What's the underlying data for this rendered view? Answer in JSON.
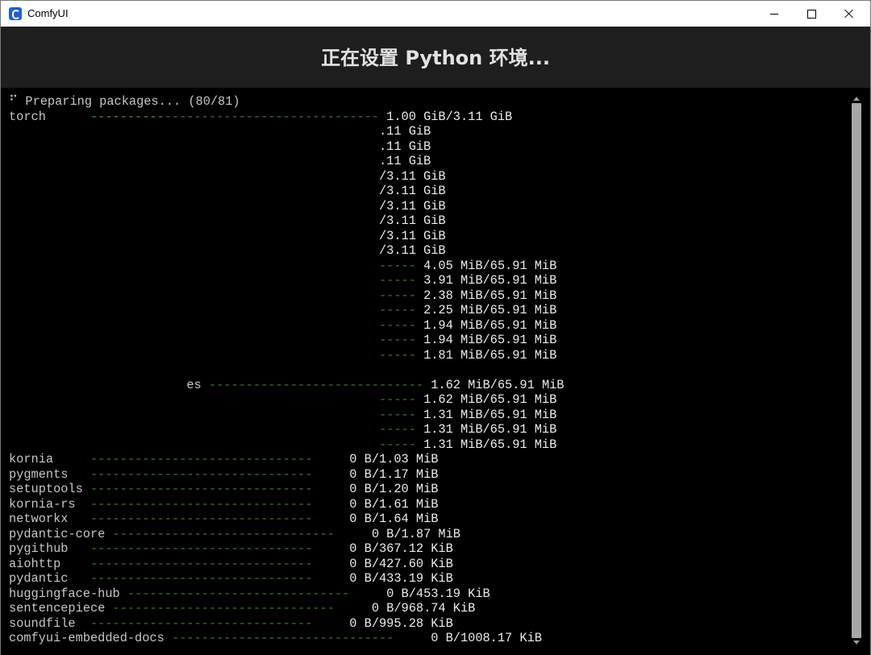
{
  "window": {
    "title": "ComfyUI",
    "icon": "comfyui-logo-icon",
    "controls": {
      "minimize": "minimize-icon",
      "maximize": "maximize-icon",
      "close": "close-icon"
    }
  },
  "header": {
    "title": "正在设置 Python 环境..."
  },
  "terminal": {
    "lines": [
      {
        "pre": "",
        "label": "⠋ Preparing packages... (80/81)",
        "dim": "",
        "bar": "",
        "value": ""
      },
      {
        "pre": "",
        "label": "torch      ",
        "dim": "",
        "bar": "----------------------------- ",
        "value": "1.00 GiB/3.11 GiB",
        "bright_dash": "----------"
      },
      {
        "pre": "                                                  ",
        "label": "",
        "dim": "",
        "bar": "",
        "value": ".11 GiB"
      },
      {
        "pre": "                                                  ",
        "label": "",
        "dim": "",
        "bar": "",
        "value": ".11 GiB"
      },
      {
        "pre": "                                                  ",
        "label": "",
        "dim": "",
        "bar": "",
        "value": ".11 GiB"
      },
      {
        "pre": "                                                  ",
        "label": "",
        "dim": "",
        "bar": "",
        "value": "/3.11 GiB"
      },
      {
        "pre": "                                                  ",
        "label": "",
        "dim": "",
        "bar": "",
        "value": "/3.11 GiB"
      },
      {
        "pre": "                                                  ",
        "label": "",
        "dim": "",
        "bar": "",
        "value": "/3.11 GiB"
      },
      {
        "pre": "                                                  ",
        "label": "",
        "dim": "",
        "bar": "",
        "value": "/3.11 GiB"
      },
      {
        "pre": "                                                  ",
        "label": "",
        "dim": "",
        "bar": "",
        "value": "/3.11 GiB"
      },
      {
        "pre": "                                                  ",
        "label": "",
        "dim": "",
        "bar": "",
        "value": "/3.11 GiB"
      },
      {
        "pre": "                                                  ",
        "label": "",
        "dim": "",
        "bar": "----- ",
        "value": "4.05 MiB/65.91 MiB"
      },
      {
        "pre": "                                                  ",
        "label": "",
        "dim": "",
        "bar": "----- ",
        "value": "3.91 MiB/65.91 MiB"
      },
      {
        "pre": "                                                  ",
        "label": "",
        "dim": "",
        "bar": "----- ",
        "value": "2.38 MiB/65.91 MiB"
      },
      {
        "pre": "                                                  ",
        "label": "",
        "dim": "",
        "bar": "----- ",
        "value": "2.25 MiB/65.91 MiB"
      },
      {
        "pre": "                                                  ",
        "label": "",
        "dim": "",
        "bar": "----- ",
        "value": "1.94 MiB/65.91 MiB"
      },
      {
        "pre": "                                                  ",
        "label": "",
        "dim": "",
        "bar": "----- ",
        "value": "1.94 MiB/65.91 MiB"
      },
      {
        "pre": "                                                  ",
        "label": "",
        "dim": "",
        "bar": "----- ",
        "value": "1.81 MiB/65.91 MiB"
      },
      {
        "pre": "",
        "label": "",
        "dim": "",
        "bar": "",
        "value": ""
      },
      {
        "pre": "                        ",
        "label": "es ",
        "dim": "",
        "bar": "----------------------------- ",
        "value": "1.62 MiB/65.91 MiB"
      },
      {
        "pre": "                                                  ",
        "label": "",
        "dim": "",
        "bar": "----- ",
        "value": "1.62 MiB/65.91 MiB"
      },
      {
        "pre": "                                                  ",
        "label": "",
        "dim": "",
        "bar": "----- ",
        "value": "1.31 MiB/65.91 MiB"
      },
      {
        "pre": "                                                  ",
        "label": "",
        "dim": "",
        "bar": "----- ",
        "value": "1.31 MiB/65.91 MiB"
      },
      {
        "pre": "                                                  ",
        "label": "",
        "dim": "",
        "bar": "----- ",
        "value": "1.31 MiB/65.91 MiB"
      },
      {
        "pre": "",
        "label": "kornia     ",
        "dim": "",
        "bar": "------------------------------     ",
        "value": "0 B/1.03 MiB"
      },
      {
        "pre": "",
        "label": "pygments   ",
        "dim": "",
        "bar": "------------------------------     ",
        "value": "0 B/1.17 MiB"
      },
      {
        "pre": "",
        "label": "setuptools ",
        "dim": "",
        "bar": "------------------------------     ",
        "value": "0 B/1.20 MiB"
      },
      {
        "pre": "",
        "label": "kornia-rs  ",
        "dim": "",
        "bar": "------------------------------     ",
        "value": "0 B/1.61 MiB"
      },
      {
        "pre": "",
        "label": "networkx   ",
        "dim": "",
        "bar": "------------------------------     ",
        "value": "0 B/1.64 MiB"
      },
      {
        "pre": "",
        "label": "pydantic-core ",
        "dim": "",
        "bar": "------------------------------     ",
        "value": "0 B/1.87 MiB"
      },
      {
        "pre": "",
        "label": "pygithub   ",
        "dim": "",
        "bar": "------------------------------     ",
        "value": "0 B/367.12 KiB"
      },
      {
        "pre": "",
        "label": "aiohttp    ",
        "dim": "",
        "bar": "------------------------------     ",
        "value": "0 B/427.60 KiB"
      },
      {
        "pre": "",
        "label": "pydantic   ",
        "dim": "",
        "bar": "------------------------------     ",
        "value": "0 B/433.19 KiB"
      },
      {
        "pre": "",
        "label": "huggingface-hub ",
        "dim": "",
        "bar": "------------------------------     ",
        "value": "0 B/453.19 KiB"
      },
      {
        "pre": "",
        "label": "sentencepiece ",
        "dim": "",
        "bar": "------------------------------     ",
        "value": "0 B/968.74 KiB"
      },
      {
        "pre": "",
        "label": "soundfile  ",
        "dim": "",
        "bar": "------------------------------     ",
        "value": "0 B/995.28 KiB"
      },
      {
        "pre": "",
        "label": "comfyui-embedded-docs ",
        "dim": "",
        "bar": "------------------------------     ",
        "value": "0 B/1008.17 KiB"
      }
    ]
  },
  "colors": {
    "terminal_bg": "#000000",
    "header_bg": "#1e1e1e",
    "progress_bar": "#3b7a2b",
    "text": "#c6c6c6"
  }
}
